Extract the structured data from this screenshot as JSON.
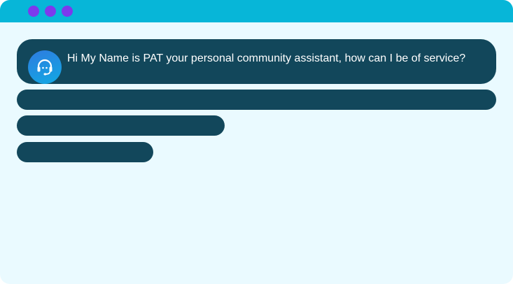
{
  "window": {
    "titlebar_color": "#07b6d8",
    "window_control_color": "#7c3aed",
    "background_color": "#eafaff"
  },
  "chat": {
    "assistant_avatar_icon": "headset-support-icon",
    "message": "Hi My Name is PAT your personal community assistant, how can I be of service?",
    "bubble_color": "#12475b"
  }
}
